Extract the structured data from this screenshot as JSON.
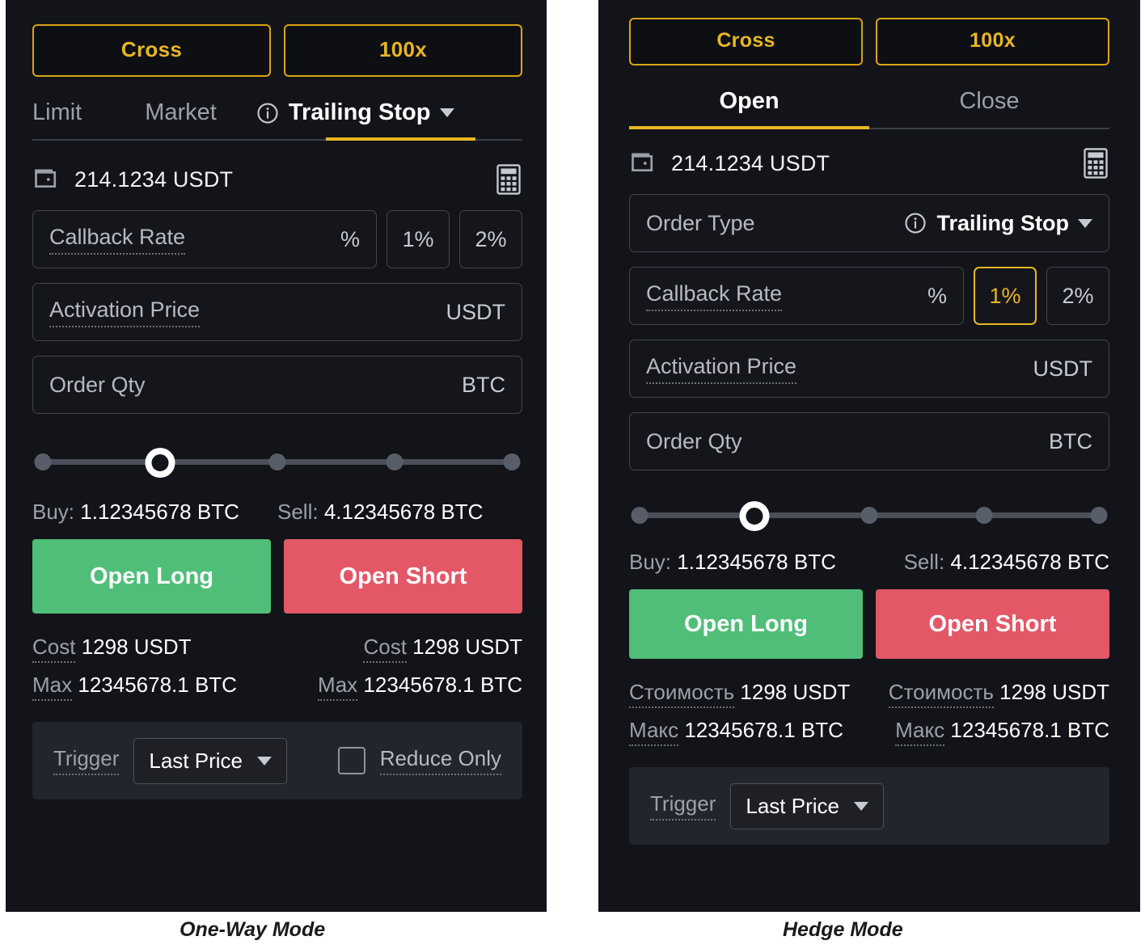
{
  "colors": {
    "accent_yellow": "#e8b624",
    "panel_bg": "#131419",
    "long_green": "#50be78",
    "short_red": "#e35767",
    "text_primary": "#ffffff",
    "text_muted": "#9ba0ab",
    "field_border": "#40454f"
  },
  "one_way": {
    "caption": "One-Way Mode",
    "leverage": {
      "margin_mode": "Cross",
      "leverage_value": "100x"
    },
    "order_tabs": [
      {
        "label": "Limit",
        "active": false
      },
      {
        "label": "Market",
        "active": false
      },
      {
        "label": "Trailing Stop",
        "active": true
      }
    ],
    "balance": {
      "amount": "214.1234 USDT"
    },
    "callback_rate": {
      "label": "Callback Rate",
      "suffix": "%",
      "presets": [
        {
          "label": "1%",
          "selected": false
        },
        {
          "label": "2%",
          "selected": false
        }
      ]
    },
    "activation_price": {
      "label": "Activation Price",
      "suffix": "USDT"
    },
    "order_qty": {
      "label": "Order Qty",
      "suffix": "BTC"
    },
    "slider": {
      "value_pct": 25,
      "stops": [
        0,
        25,
        50,
        75,
        100
      ]
    },
    "buy": {
      "label": "Buy:",
      "value": "1.12345678 BTC"
    },
    "sell": {
      "label": "Sell:",
      "value": "4.12345678 BTC"
    },
    "actions": {
      "long": "Open Long",
      "short": "Open Short"
    },
    "long_stats": {
      "cost_label": "Cost",
      "cost_value": "1298 USDT",
      "max_label": "Max",
      "max_value": "12345678.1 BTC"
    },
    "short_stats": {
      "cost_label": "Cost",
      "cost_value": "1298 USDT",
      "max_label": "Max",
      "max_value": "12345678.1 BTC"
    },
    "trigger": {
      "label": "Trigger",
      "selected": "Last Price",
      "reduce_only_label": "Reduce Only",
      "reduce_only_checked": false
    }
  },
  "hedge": {
    "caption": "Hedge Mode",
    "leverage": {
      "margin_mode": "Cross",
      "leverage_value": "100x"
    },
    "position_tabs": [
      {
        "label": "Open",
        "active": true
      },
      {
        "label": "Close",
        "active": false
      }
    ],
    "balance": {
      "amount": "214.1234 USDT"
    },
    "order_type": {
      "label": "Order Type",
      "value": "Trailing Stop"
    },
    "callback_rate": {
      "label": "Callback Rate",
      "suffix": "%",
      "presets": [
        {
          "label": "1%",
          "selected": true
        },
        {
          "label": "2%",
          "selected": false
        }
      ]
    },
    "activation_price": {
      "label": "Activation Price",
      "suffix": "USDT"
    },
    "order_qty": {
      "label": "Order Qty",
      "suffix": "BTC"
    },
    "slider": {
      "value_pct": 25,
      "stops": [
        0,
        25,
        50,
        75,
        100
      ]
    },
    "buy": {
      "label": "Buy:",
      "value": "1.12345678 BTC"
    },
    "sell": {
      "label": "Sell:",
      "value": "4.12345678 BTC"
    },
    "actions": {
      "long": "Open Long",
      "short": "Open Short"
    },
    "long_stats": {
      "cost_label": "Стоимость",
      "cost_value": "1298 USDT",
      "max_label": "Макс",
      "max_value": "12345678.1 BTC"
    },
    "short_stats": {
      "cost_label": "Стоимость",
      "cost_value": "1298 USDT",
      "max_label": "Макс",
      "max_value": "12345678.1 BTC"
    },
    "trigger": {
      "label": "Trigger",
      "selected": "Last Price"
    }
  },
  "icons": {
    "wallet": "wallet-icon",
    "calculator": "calculator-icon",
    "info": "info-icon",
    "chevron_down": "chevron-down-icon"
  }
}
